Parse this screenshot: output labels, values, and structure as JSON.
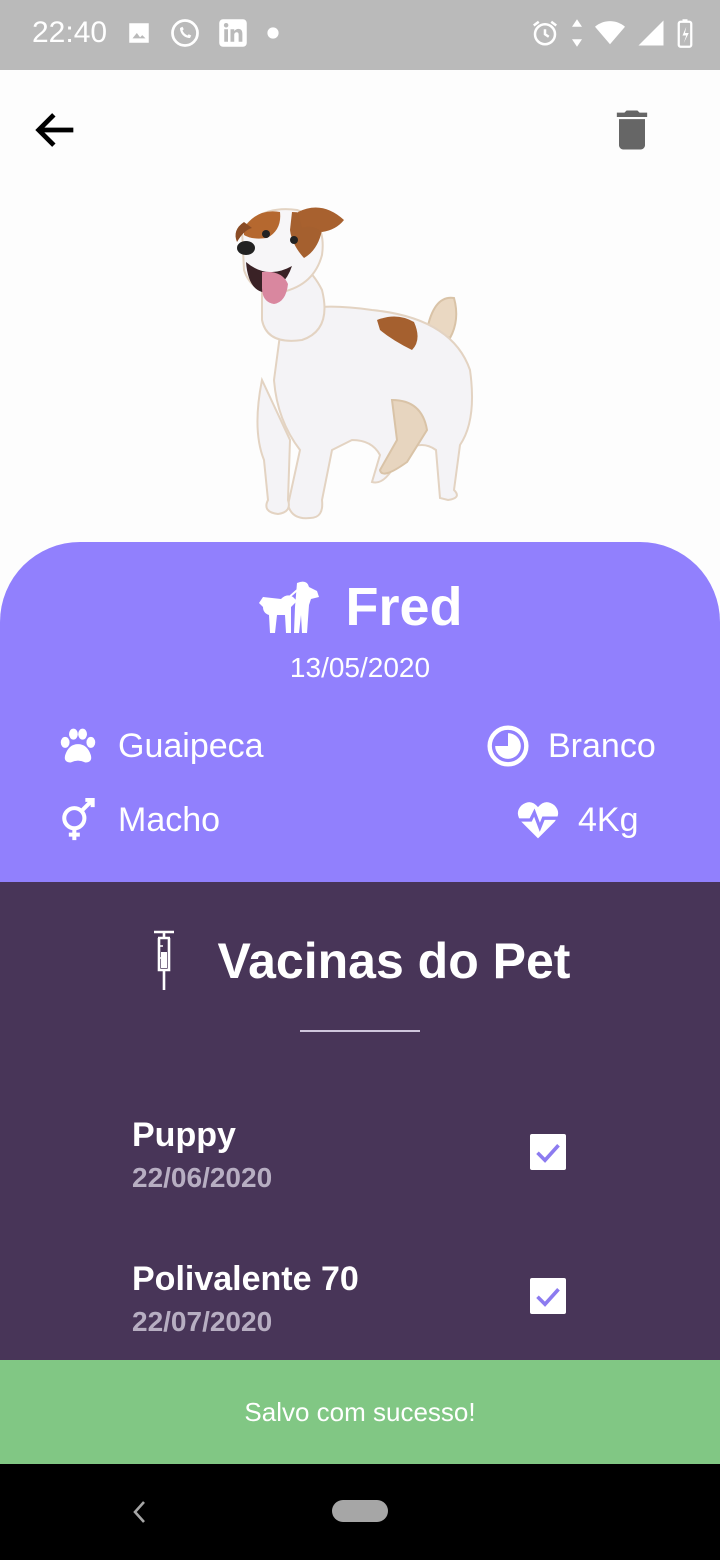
{
  "status_bar": {
    "time": "22:40",
    "left_icons": [
      "image-icon",
      "whatsapp-icon",
      "linkedin-icon",
      "dot-icon"
    ],
    "right_icons": [
      "alarm-icon",
      "data-arrows-icon",
      "wifi-icon",
      "signal-icon",
      "battery-icon"
    ]
  },
  "app_bar": {
    "back_icon": "arrow-left-icon",
    "delete_icon": "trash-icon"
  },
  "pet": {
    "name": "Fred",
    "birth_date": "13/05/2020",
    "breed": "Guaipeca",
    "color": "Branco",
    "sex": "Macho",
    "weight": "4Kg"
  },
  "vaccines": {
    "title": "Vacinas do Pet",
    "items": [
      {
        "name": "Puppy",
        "date": "22/06/2020",
        "checked": true
      },
      {
        "name": "Polivalente 70",
        "date": "22/07/2020",
        "checked": true
      }
    ]
  },
  "snackbar": {
    "message": "Salvo com sucesso!"
  },
  "colors": {
    "accent": "#9180fd",
    "vaccine_bg": "#483558",
    "snackbar_bg": "#81c784",
    "check_mark": "#8c7bf0"
  }
}
